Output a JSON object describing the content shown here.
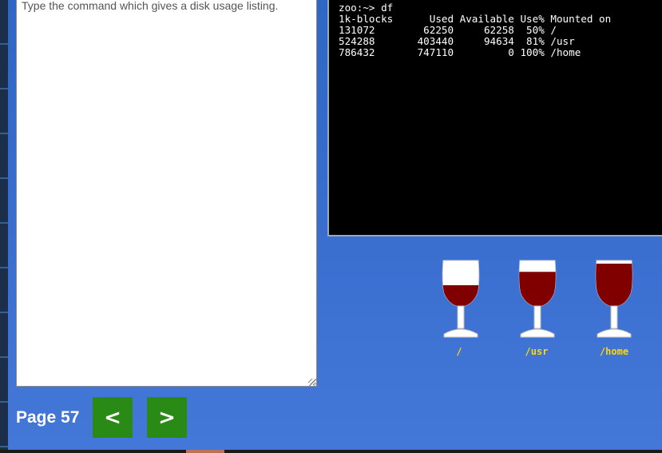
{
  "prompt": {
    "text": "Type the command which gives a disk usage listing."
  },
  "terminal": {
    "lines": [
      "zoo:~> df",
      "1k-blocks      Used Available Use% Mounted on",
      "131072        62250     62258  50% /",
      "524288       403440     94634  81% /usr",
      "786432       747110         0 100% /home"
    ]
  },
  "glasses": [
    {
      "label": "/",
      "fill": 0.5
    },
    {
      "label": "/usr",
      "fill": 0.81
    },
    {
      "label": "/home",
      "fill": 1.0
    }
  ],
  "colors": {
    "wine": "#800000",
    "label": "#ffd800",
    "button": "#2a8a16"
  },
  "footer": {
    "page_label": "Page 57",
    "prev_label": "<",
    "next_label": ">"
  }
}
